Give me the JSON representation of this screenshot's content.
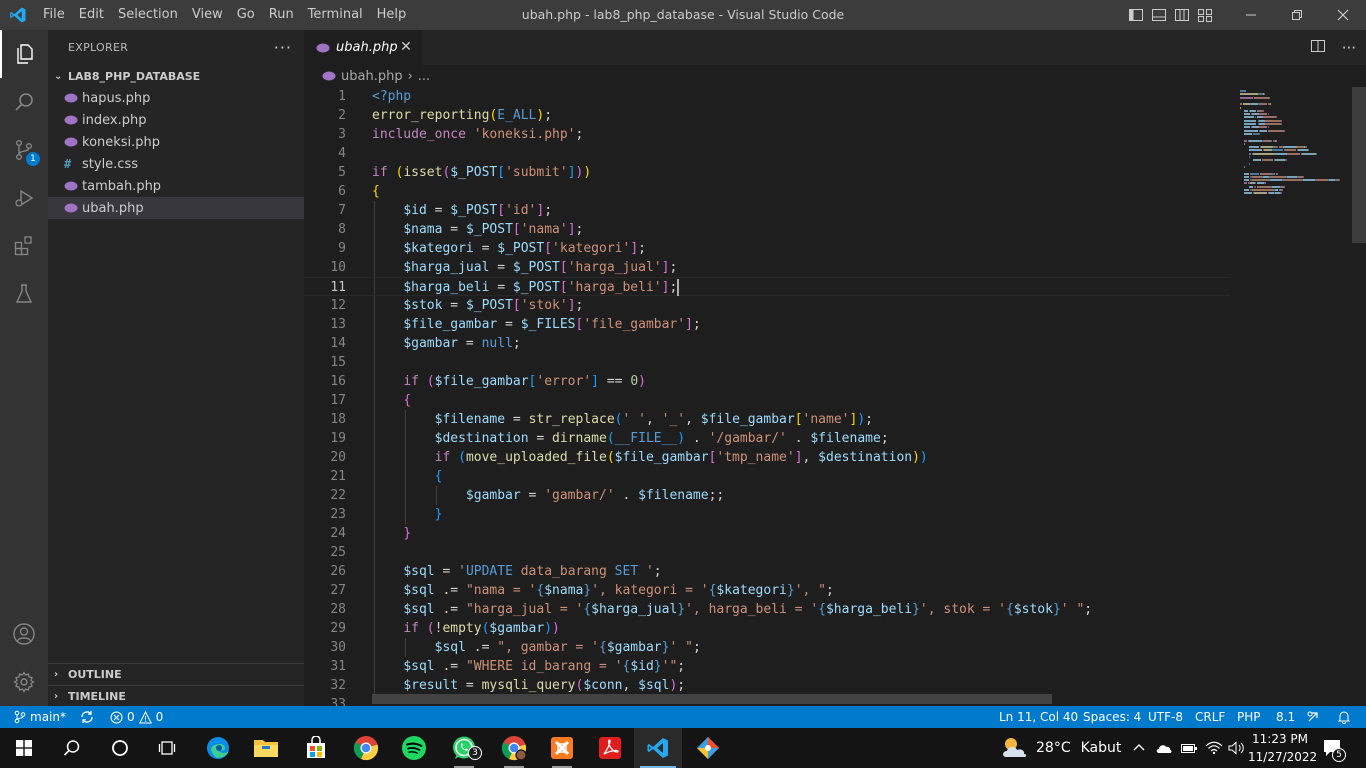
{
  "window": {
    "title": "ubah.php - lab8_php_database - Visual Studio Code",
    "menu": [
      "File",
      "Edit",
      "Selection",
      "View",
      "Go",
      "Run",
      "Terminal",
      "Help"
    ]
  },
  "activity": {
    "source_control_badge": "1"
  },
  "sidebar": {
    "title": "EXPLORER",
    "more": "···",
    "folder": "LAB8_PHP_DATABASE",
    "files": [
      {
        "name": "hapus.php",
        "type": "php"
      },
      {
        "name": "index.php",
        "type": "php"
      },
      {
        "name": "koneksi.php",
        "type": "php"
      },
      {
        "name": "style.css",
        "type": "css"
      },
      {
        "name": "tambah.php",
        "type": "php"
      },
      {
        "name": "ubah.php",
        "type": "php",
        "selected": true
      }
    ],
    "outline": "OUTLINE",
    "timeline": "TIMELINE"
  },
  "editor": {
    "tab": {
      "label": "ubah.php",
      "close": "✕"
    },
    "breadcrumb": {
      "file": "ubah.php",
      "separator": "›",
      "more": "..."
    },
    "current_line": 11,
    "lines": [
      [
        [
          "k",
          "<?php"
        ]
      ],
      [
        [
          "f",
          "error_reporting"
        ],
        [
          "b1",
          "("
        ],
        [
          "k",
          "E_ALL"
        ],
        [
          "b1",
          ")"
        ],
        [
          "p",
          ";"
        ]
      ],
      [
        [
          "c",
          "include_once"
        ],
        [
          "p",
          " "
        ],
        [
          "s",
          "'koneksi.php'"
        ],
        [
          "p",
          ";"
        ]
      ],
      [],
      [
        [
          "c",
          "if"
        ],
        [
          "p",
          " "
        ],
        [
          "b1",
          "("
        ],
        [
          "f",
          "isset"
        ],
        [
          "b2",
          "("
        ],
        [
          "v",
          "$_POST"
        ],
        [
          "b3",
          "["
        ],
        [
          "s",
          "'submit'"
        ],
        [
          "b3",
          "]"
        ],
        [
          "b2",
          ")"
        ],
        [
          "b1",
          ")"
        ]
      ],
      [
        [
          "b1",
          "{"
        ]
      ],
      [
        [
          "p",
          "    "
        ],
        [
          "v",
          "$id"
        ],
        [
          "p",
          " = "
        ],
        [
          "v",
          "$_POST"
        ],
        [
          "b2",
          "["
        ],
        [
          "s",
          "'id'"
        ],
        [
          "b2",
          "]"
        ],
        [
          "p",
          ";"
        ]
      ],
      [
        [
          "p",
          "    "
        ],
        [
          "v",
          "$nama"
        ],
        [
          "p",
          " = "
        ],
        [
          "v",
          "$_POST"
        ],
        [
          "b2",
          "["
        ],
        [
          "s",
          "'nama'"
        ],
        [
          "b2",
          "]"
        ],
        [
          "p",
          ";"
        ]
      ],
      [
        [
          "p",
          "    "
        ],
        [
          "v",
          "$kategori"
        ],
        [
          "p",
          " = "
        ],
        [
          "v",
          "$_POST"
        ],
        [
          "b2",
          "["
        ],
        [
          "s",
          "'kategori'"
        ],
        [
          "b2",
          "]"
        ],
        [
          "p",
          ";"
        ]
      ],
      [
        [
          "p",
          "    "
        ],
        [
          "v",
          "$harga_jual"
        ],
        [
          "p",
          " = "
        ],
        [
          "v",
          "$_POST"
        ],
        [
          "b2",
          "["
        ],
        [
          "s",
          "'harga_jual'"
        ],
        [
          "b2",
          "]"
        ],
        [
          "p",
          ";"
        ]
      ],
      [
        [
          "p",
          "    "
        ],
        [
          "v",
          "$harga_beli"
        ],
        [
          "p",
          " = "
        ],
        [
          "v",
          "$_POST"
        ],
        [
          "b2",
          "["
        ],
        [
          "s",
          "'harga_beli'"
        ],
        [
          "b2",
          "]"
        ],
        [
          "p",
          ";"
        ],
        [
          "cursor",
          ""
        ]
      ],
      [
        [
          "p",
          "    "
        ],
        [
          "v",
          "$stok"
        ],
        [
          "p",
          " = "
        ],
        [
          "v",
          "$_POST"
        ],
        [
          "b2",
          "["
        ],
        [
          "s",
          "'stok'"
        ],
        [
          "b2",
          "]"
        ],
        [
          "p",
          ";"
        ]
      ],
      [
        [
          "p",
          "    "
        ],
        [
          "v",
          "$file_gambar"
        ],
        [
          "p",
          " = "
        ],
        [
          "v",
          "$_FILES"
        ],
        [
          "b2",
          "["
        ],
        [
          "s",
          "'file_gambar'"
        ],
        [
          "b2",
          "]"
        ],
        [
          "p",
          ";"
        ]
      ],
      [
        [
          "p",
          "    "
        ],
        [
          "v",
          "$gambar"
        ],
        [
          "p",
          " = "
        ],
        [
          "k",
          "null"
        ],
        [
          "p",
          ";"
        ]
      ],
      [],
      [
        [
          "p",
          "    "
        ],
        [
          "c",
          "if"
        ],
        [
          "p",
          " "
        ],
        [
          "b2",
          "("
        ],
        [
          "v",
          "$file_gambar"
        ],
        [
          "b3",
          "["
        ],
        [
          "s",
          "'error'"
        ],
        [
          "b3",
          "]"
        ],
        [
          "p",
          " == "
        ],
        [
          "n",
          "0"
        ],
        [
          "b2",
          ")"
        ]
      ],
      [
        [
          "p",
          "    "
        ],
        [
          "b2",
          "{"
        ]
      ],
      [
        [
          "p",
          "        "
        ],
        [
          "v",
          "$filename"
        ],
        [
          "p",
          " = "
        ],
        [
          "f",
          "str_replace"
        ],
        [
          "b3",
          "("
        ],
        [
          "s",
          "' '"
        ],
        [
          "p",
          ", "
        ],
        [
          "s",
          "'_'"
        ],
        [
          "p",
          ", "
        ],
        [
          "v",
          "$file_gambar"
        ],
        [
          "b1",
          "["
        ],
        [
          "s",
          "'name'"
        ],
        [
          "b1",
          "]"
        ],
        [
          "b3",
          ")"
        ],
        [
          "p",
          ";"
        ]
      ],
      [
        [
          "p",
          "        "
        ],
        [
          "v",
          "$destination"
        ],
        [
          "p",
          " = "
        ],
        [
          "f",
          "dirname"
        ],
        [
          "b3",
          "("
        ],
        [
          "k",
          "__FILE__"
        ],
        [
          "b3",
          ")"
        ],
        [
          "p",
          " . "
        ],
        [
          "s",
          "'/gambar/'"
        ],
        [
          "p",
          " . "
        ],
        [
          "v",
          "$filename"
        ],
        [
          "p",
          ";"
        ]
      ],
      [
        [
          "p",
          "        "
        ],
        [
          "c",
          "if"
        ],
        [
          "p",
          " "
        ],
        [
          "b3",
          "("
        ],
        [
          "f",
          "move_uploaded_file"
        ],
        [
          "b1",
          "("
        ],
        [
          "v",
          "$file_gambar"
        ],
        [
          "b2",
          "["
        ],
        [
          "s",
          "'tmp_name'"
        ],
        [
          "b2",
          "]"
        ],
        [
          "p",
          ", "
        ],
        [
          "v",
          "$destination"
        ],
        [
          "b1",
          ")"
        ],
        [
          "b3",
          ")"
        ]
      ],
      [
        [
          "p",
          "        "
        ],
        [
          "b3",
          "{"
        ]
      ],
      [
        [
          "p",
          "            "
        ],
        [
          "v",
          "$gambar"
        ],
        [
          "p",
          " = "
        ],
        [
          "s",
          "'gambar/'"
        ],
        [
          "p",
          " . "
        ],
        [
          "v",
          "$filename"
        ],
        [
          "p",
          ";;"
        ]
      ],
      [
        [
          "p",
          "        "
        ],
        [
          "b3",
          "}"
        ]
      ],
      [
        [
          "p",
          "    "
        ],
        [
          "b2",
          "}"
        ]
      ],
      [],
      [
        [
          "p",
          "    "
        ],
        [
          "v",
          "$sql"
        ],
        [
          "p",
          " = "
        ],
        [
          "s",
          "'"
        ],
        [
          "k",
          "UPDATE"
        ],
        [
          "s",
          " data_barang "
        ],
        [
          "k",
          "SET"
        ],
        [
          "s",
          " '"
        ],
        [
          "p",
          ";"
        ]
      ],
      [
        [
          "p",
          "    "
        ],
        [
          "v",
          "$sql"
        ],
        [
          "p",
          " .= "
        ],
        [
          "s",
          "\"nama = '"
        ],
        [
          "k",
          "{"
        ],
        [
          "v",
          "$nama"
        ],
        [
          "k",
          "}"
        ],
        [
          "s",
          "', kategori = '"
        ],
        [
          "k",
          "{"
        ],
        [
          "v",
          "$kategori"
        ],
        [
          "k",
          "}"
        ],
        [
          "s",
          "', \""
        ],
        [
          "p",
          ";"
        ]
      ],
      [
        [
          "p",
          "    "
        ],
        [
          "v",
          "$sql"
        ],
        [
          "p",
          " .= "
        ],
        [
          "s",
          "\"harga_jual = '"
        ],
        [
          "k",
          "{"
        ],
        [
          "v",
          "$harga_jual"
        ],
        [
          "k",
          "}"
        ],
        [
          "s",
          "', harga_beli = '"
        ],
        [
          "k",
          "{"
        ],
        [
          "v",
          "$harga_beli"
        ],
        [
          "k",
          "}"
        ],
        [
          "s",
          "', stok = '"
        ],
        [
          "k",
          "{"
        ],
        [
          "v",
          "$stok"
        ],
        [
          "k",
          "}"
        ],
        [
          "s",
          "' \""
        ],
        [
          "p",
          ";"
        ]
      ],
      [
        [
          "p",
          "    "
        ],
        [
          "c",
          "if"
        ],
        [
          "p",
          " "
        ],
        [
          "b2",
          "("
        ],
        [
          "p",
          "!"
        ],
        [
          "f",
          "empty"
        ],
        [
          "b3",
          "("
        ],
        [
          "v",
          "$gambar"
        ],
        [
          "b3",
          ")"
        ],
        [
          "b2",
          ")"
        ]
      ],
      [
        [
          "p",
          "        "
        ],
        [
          "v",
          "$sql"
        ],
        [
          "p",
          " .= "
        ],
        [
          "s",
          "\", gambar = '"
        ],
        [
          "k",
          "{"
        ],
        [
          "v",
          "$gambar"
        ],
        [
          "k",
          "}"
        ],
        [
          "s",
          "' \""
        ],
        [
          "p",
          ";"
        ]
      ],
      [
        [
          "p",
          "    "
        ],
        [
          "v",
          "$sql"
        ],
        [
          "p",
          " .= "
        ],
        [
          "s",
          "\"WHERE id_barang = '"
        ],
        [
          "k",
          "{"
        ],
        [
          "v",
          "$id"
        ],
        [
          "k",
          "}"
        ],
        [
          "s",
          "'\""
        ],
        [
          "p",
          ";"
        ]
      ],
      [
        [
          "p",
          "    "
        ],
        [
          "v",
          "$result"
        ],
        [
          "p",
          " = "
        ],
        [
          "f",
          "mysqli_query"
        ],
        [
          "b2",
          "("
        ],
        [
          "v",
          "$conn"
        ],
        [
          "p",
          ", "
        ],
        [
          "v",
          "$sql"
        ],
        [
          "b2",
          ")"
        ],
        [
          "p",
          ";"
        ]
      ],
      []
    ]
  },
  "statusbar": {
    "branch": "main*",
    "errors": "0",
    "warnings": "0",
    "position": "Ln 11, Col 40",
    "spaces": "Spaces: 4",
    "encoding": "UTF-8",
    "eol": "CRLF",
    "language": "PHP",
    "version": "8.1"
  },
  "taskbar": {
    "weather_temp": "28°C",
    "weather_desc": "Kabut",
    "time": "11:23 PM",
    "date": "11/27/2022",
    "notifications": "5",
    "whatsapp_badge": "3"
  },
  "colors": {
    "accent": "#007acc",
    "titlebar": "#3c3c3c",
    "activitybar": "#333333",
    "sidebar": "#252526",
    "editor": "#1e1e1e"
  }
}
